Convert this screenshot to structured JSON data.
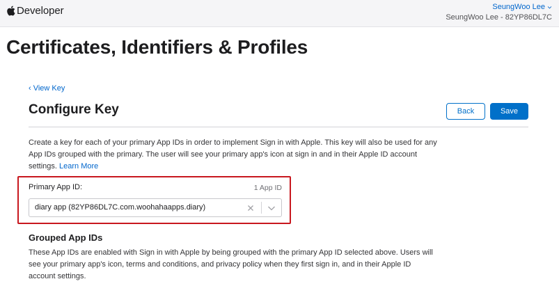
{
  "header": {
    "brand": "Developer",
    "user_name": "SeungWoo Lee",
    "team": "SeungWoo Lee - 82YP86DL7C"
  },
  "page": {
    "title": "Certificates, Identifiers & Profiles"
  },
  "configure": {
    "back_link": "‹ View Key",
    "title": "Configure Key",
    "back_button": "Back",
    "save_button": "Save",
    "description": "Create a key for each of your primary App IDs in order to implement Sign in with Apple. This key will also be used for any App IDs grouped with the primary. The user will see your primary app's icon at sign in and in their Apple ID account settings.",
    "learn_more": "Learn More",
    "primary_label": "Primary App ID:",
    "primary_count": "1 App ID",
    "primary_value": "diary app (82YP86DL7C.com.woohahaapps.diary)",
    "grouped_title": "Grouped App IDs",
    "grouped_desc": "These App IDs are enabled with Sign in with Apple by being grouped with the primary App ID selected above. Users will see your primary app's icon, terms and conditions, and privacy policy when they first sign in, and in their Apple ID account settings."
  },
  "colors": {
    "link": "#0066cc",
    "primary_button": "#0070c9",
    "highlight_border": "#c8171e"
  },
  "icons": {
    "brand": "apple-logo-icon",
    "user_menu": "chevron-down-icon",
    "clear": "close-icon",
    "dropdown": "chevron-down-icon"
  }
}
